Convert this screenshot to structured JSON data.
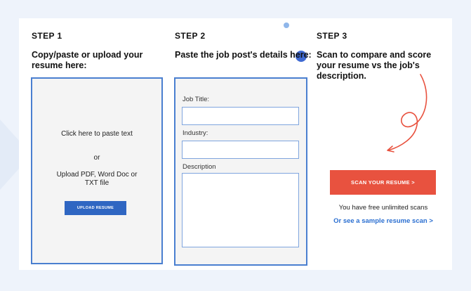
{
  "step1": {
    "title": "STEP 1",
    "description": "Copy/paste or upload your resume here:",
    "paste_text": "Click here to paste text",
    "or_text": "or",
    "upload_text": "Upload PDF, Word Doc or TXT file",
    "upload_button_label": "UPLOAD RESUME"
  },
  "step2": {
    "title": "STEP 2",
    "description": "Paste the job post's details here:",
    "fields": {
      "job_title_label": "Job Title:",
      "job_title_value": "",
      "industry_label": "Industry:",
      "industry_value": "",
      "description_label": "Description",
      "description_value": ""
    }
  },
  "step3": {
    "title": "STEP 3",
    "description": "Scan to compare and score your resume vs the job's description.",
    "scan_button_label": "SCAN YOUR RESUME >",
    "free_scans_text": "You have free unlimited scans",
    "sample_link_text": "Or see a sample resume scan >"
  },
  "colors": {
    "accent_blue": "#2f66c2",
    "border_blue": "#4a7fd0",
    "scan_red": "#e8523f",
    "link_blue": "#2b6fd1",
    "page_bg": "#eef3fb"
  },
  "icons": {
    "arrow": "curly-arrow-icon"
  }
}
